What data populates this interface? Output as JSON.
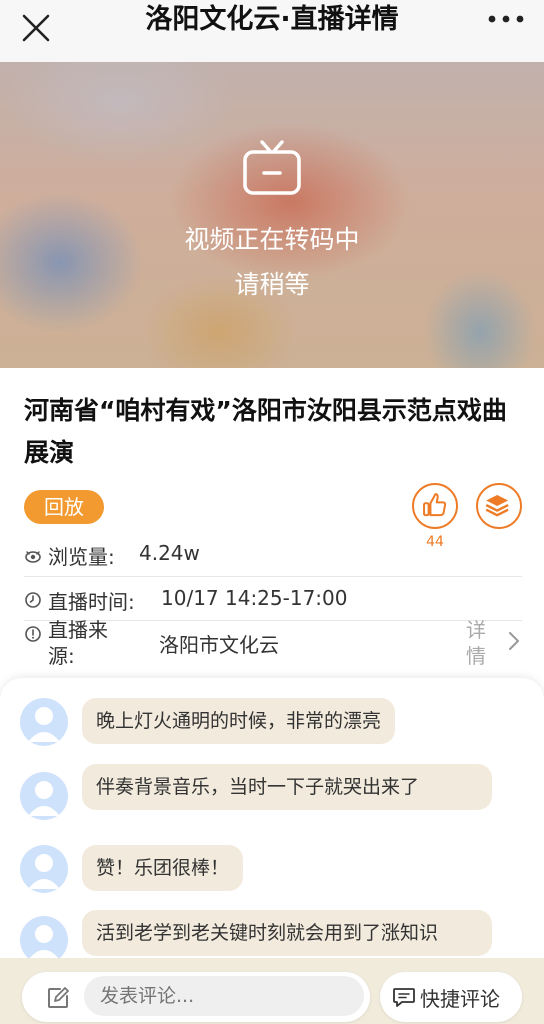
{
  "header": {
    "title": "洛阳文化云·直播详情",
    "close_icon": "close-icon",
    "more_icon": "more-icon"
  },
  "video": {
    "status_line1": "视频正在转码中",
    "status_line2": "请稍等",
    "icon": "tv-icon"
  },
  "event": {
    "title": "河南省“咱村有戏”洛阳市汝阳县示范点戏曲展演",
    "badge": "回放",
    "like_count": "44",
    "views_label": "浏览量:",
    "views_value": "4.24w",
    "time_label": "直播时间:",
    "time_value": "10/17 14:25-17:00",
    "source_label": "直播来源:",
    "source_value": "洛阳市文化云",
    "detail_label": "详情"
  },
  "comments": [
    {
      "text": "晚上灯火通明的时候，非常的漂亮"
    },
    {
      "text": "伴奏背景音乐，当时一下子就哭出来了"
    },
    {
      "text": "赞！乐团很棒！"
    },
    {
      "text": "活到老学到老关键时刻就会用到了涨知识"
    }
  ],
  "footer": {
    "input_placeholder": "发表评论...",
    "quick_comment_label": "快捷评论"
  },
  "colors": {
    "accent": "#ee7b26",
    "badge": "#f29a2f",
    "comment_bubble": "#f2ebdd",
    "bottom_bar": "#f1ebdc"
  }
}
